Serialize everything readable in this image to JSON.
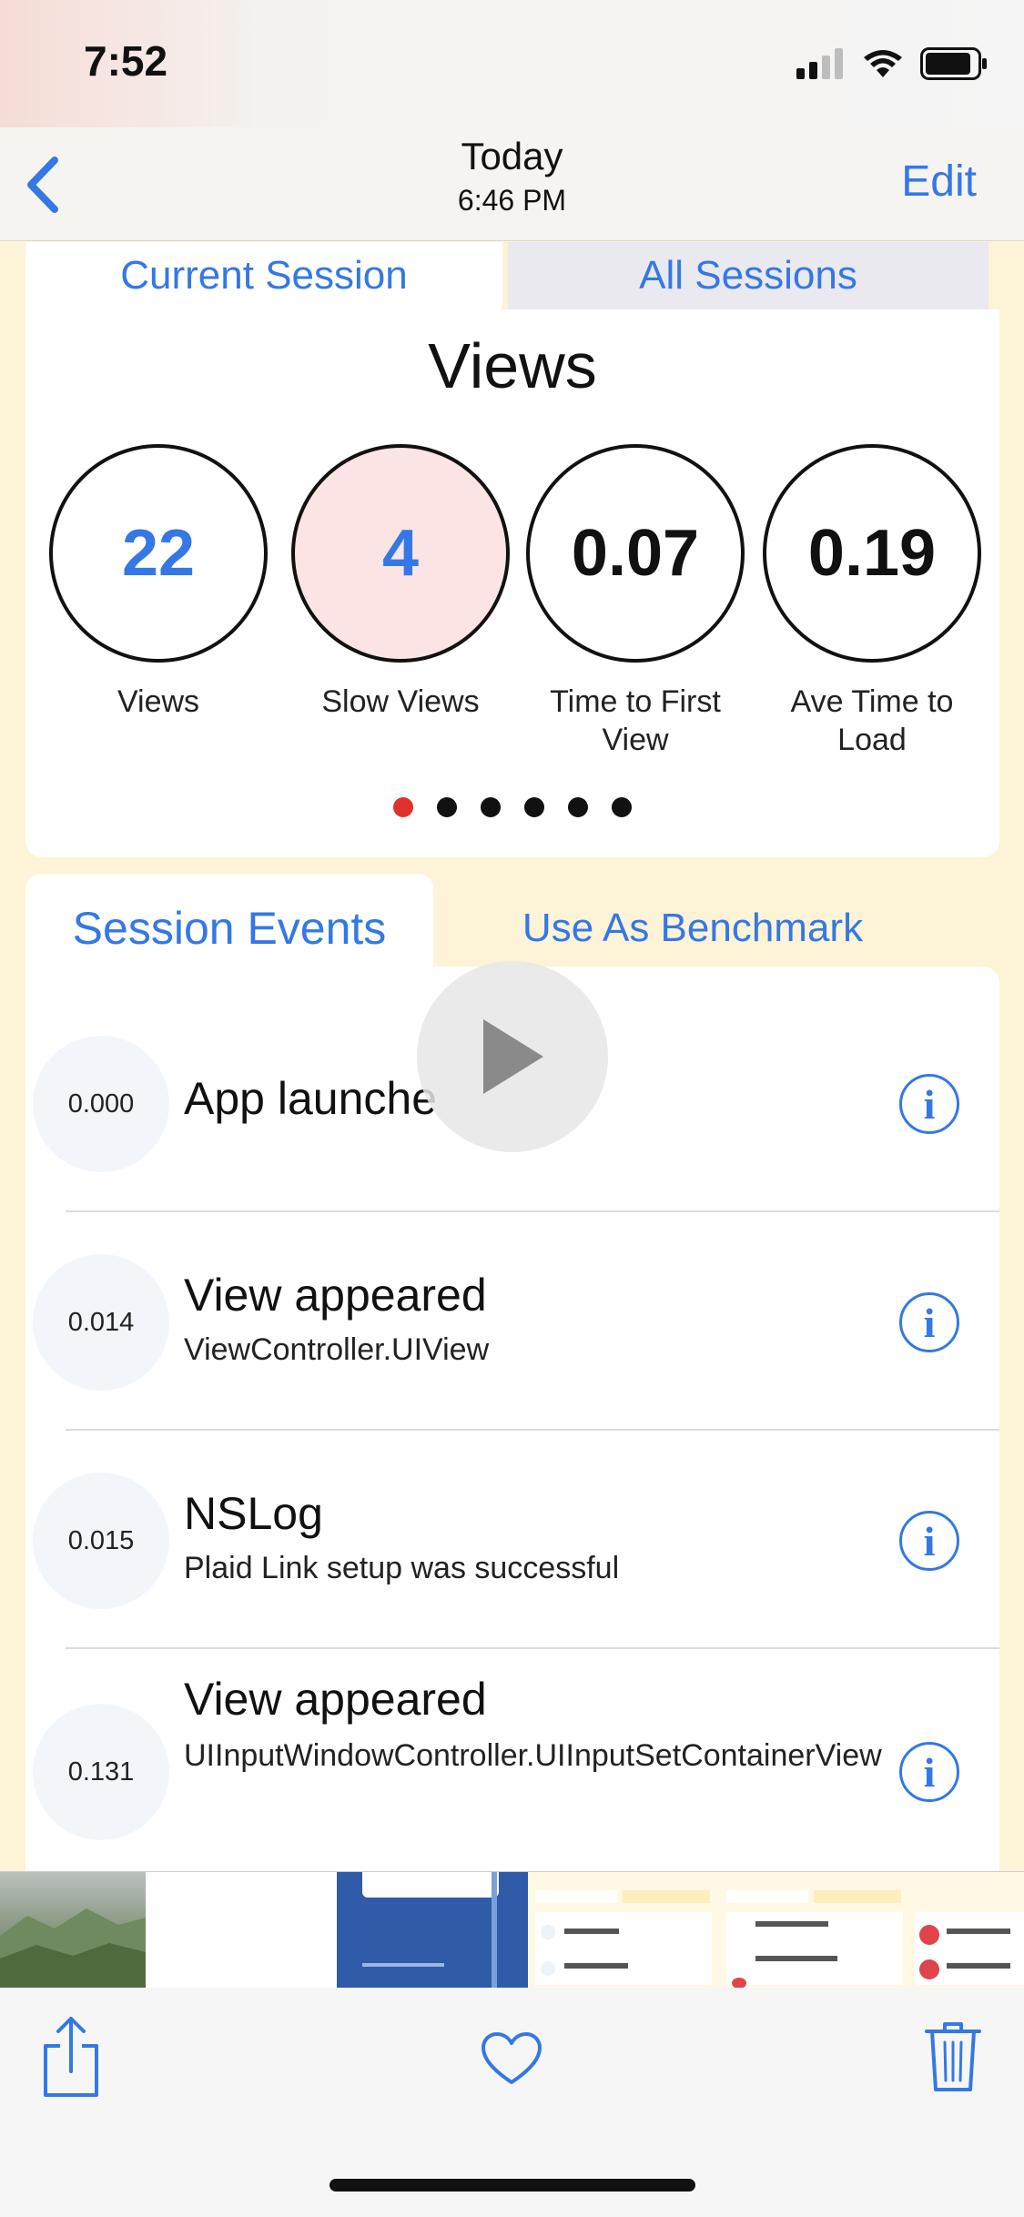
{
  "status_bar": {
    "time": "7:52"
  },
  "nav": {
    "title": "Today",
    "subtitle": "6:46 PM",
    "edit_label": "Edit"
  },
  "top_tabs": {
    "current": "Current Session",
    "all": "All Sessions"
  },
  "views_card": {
    "title": "Views",
    "metrics": [
      {
        "value": "22",
        "label": "Views"
      },
      {
        "value": "4",
        "label": "Slow Views"
      },
      {
        "value": "0.07",
        "label": "Time to First View"
      },
      {
        "value": "0.19",
        "label": "Ave Time to Load"
      }
    ],
    "page_count": 6,
    "active_page": 1
  },
  "events_tabs": {
    "events": "Session Events",
    "benchmark": "Use As Benchmark"
  },
  "events": [
    {
      "time": "0.000",
      "title": "App launche",
      "subtitle": ""
    },
    {
      "time": "0.014",
      "title": "View appeared",
      "subtitle": "ViewController.UIView"
    },
    {
      "time": "0.015",
      "title": "NSLog",
      "subtitle": "Plaid Link setup was successful"
    },
    {
      "time": "0.131",
      "title": "View appeared",
      "subtitle": "UIInputWindowController.UIInputSetContainerView"
    }
  ],
  "colors": {
    "accent": "#3478e5",
    "alert": "#e0312a",
    "slow_bg": "#fbe4e3"
  },
  "icons": [
    "back-chevron-icon",
    "signal-icon",
    "wifi-icon",
    "battery-icon",
    "info-icon",
    "play-icon",
    "share-icon",
    "heart-icon",
    "trash-icon"
  ]
}
